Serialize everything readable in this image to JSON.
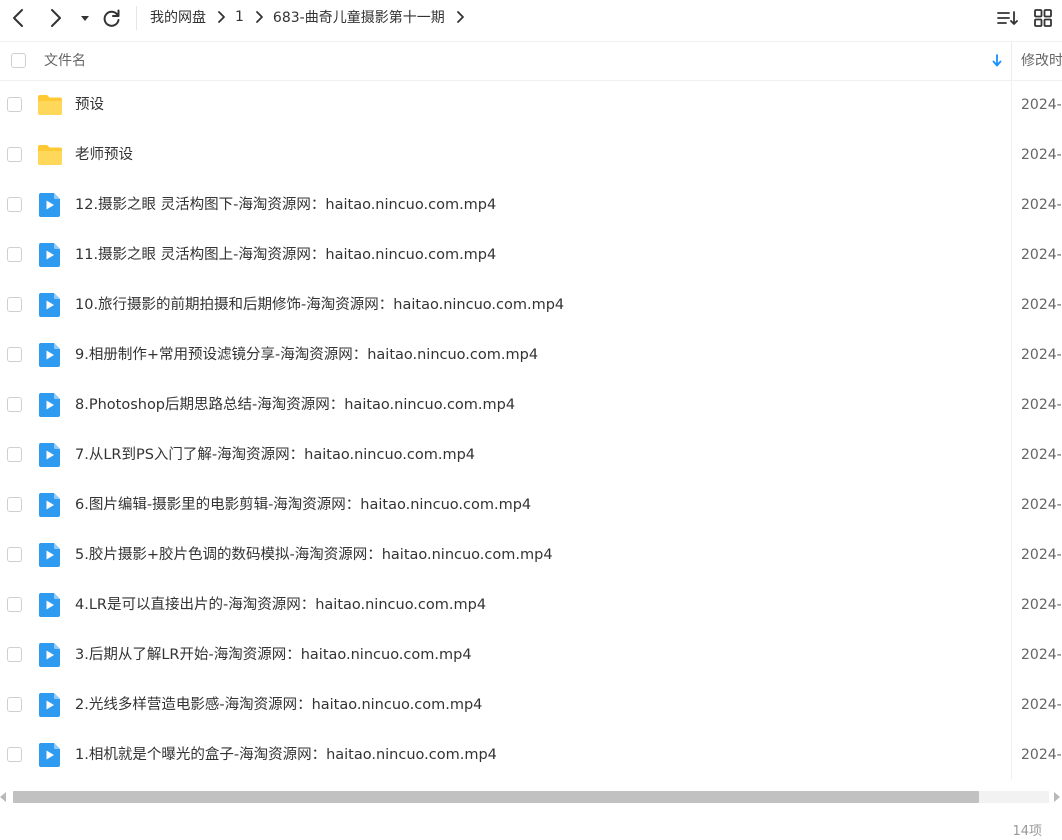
{
  "toolbar": {
    "back_icon": "chevron-left-icon",
    "forward_icon": "chevron-right-icon",
    "history_icon": "caret-down-icon",
    "refresh_icon": "refresh-icon",
    "sort_view_icon": "sort-list-icon",
    "grid_view_icon": "grid-icon"
  },
  "breadcrumb": [
    {
      "label": "我的网盘"
    },
    {
      "label": "1"
    },
    {
      "label": "683-曲奇儿童摄影第十一期"
    }
  ],
  "header": {
    "name_label": "文件名",
    "date_label": "修改时"
  },
  "files": [
    {
      "type": "folder",
      "name": "预设",
      "date": "2024-"
    },
    {
      "type": "folder",
      "name": "老师预设",
      "date": "2024-"
    },
    {
      "type": "video",
      "name": "12.摄影之眼 灵活构图下-海淘资源网：haitao.nincuo.com.mp4",
      "date": "2024-"
    },
    {
      "type": "video",
      "name": "11.摄影之眼 灵活构图上-海淘资源网：haitao.nincuo.com.mp4",
      "date": "2024-"
    },
    {
      "type": "video",
      "name": "10.旅行摄影的前期拍摄和后期修饰-海淘资源网：haitao.nincuo.com.mp4",
      "date": "2024-"
    },
    {
      "type": "video",
      "name": "9.相册制作+常用预设滤镜分享-海淘资源网：haitao.nincuo.com.mp4",
      "date": "2024-"
    },
    {
      "type": "video",
      "name": "8.Photoshop后期思路总结-海淘资源网：haitao.nincuo.com.mp4",
      "date": "2024-"
    },
    {
      "type": "video",
      "name": "7.从LR到PS入门了解-海淘资源网：haitao.nincuo.com.mp4",
      "date": "2024-"
    },
    {
      "type": "video",
      "name": "6.图片编辑-摄影里的电影剪辑-海淘资源网：haitao.nincuo.com.mp4",
      "date": "2024-"
    },
    {
      "type": "video",
      "name": "5.胶片摄影+胶片色调的数码模拟-海淘资源网：haitao.nincuo.com.mp4",
      "date": "2024-"
    },
    {
      "type": "video",
      "name": "4.LR是可以直接出片的-海淘资源网：haitao.nincuo.com.mp4",
      "date": "2024-"
    },
    {
      "type": "video",
      "name": "3.后期从了解LR开始-海淘资源网：haitao.nincuo.com.mp4",
      "date": "2024-"
    },
    {
      "type": "video",
      "name": "2.光线多样营造电影感-海淘资源网：haitao.nincuo.com.mp4",
      "date": "2024-"
    },
    {
      "type": "video",
      "name": "1.相机就是个曝光的盒子-海淘资源网：haitao.nincuo.com.mp4",
      "date": "2024-"
    }
  ],
  "footer": {
    "count_label": "14项"
  },
  "colors": {
    "folder": "#FFC933",
    "video": "#2E9BF0",
    "accent": "#1890FF"
  }
}
